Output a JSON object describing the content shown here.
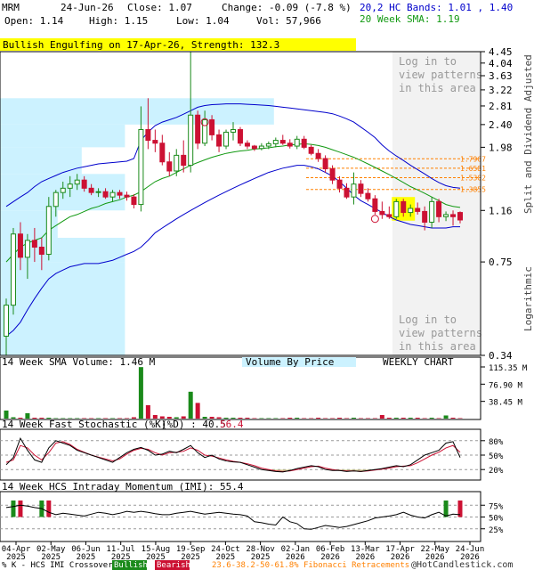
{
  "header": {
    "symbol": "MRM",
    "date": "24-Jun-26",
    "close": "Close: 1.07",
    "change": "Change: -0.09 (-7.8 %)",
    "open": "Open: 1.14",
    "high": "High: 1.15",
    "low": "Low: 1.04",
    "vol": "Vol: 57,966",
    "bands": "20,2 HC Bands: 1.01 , 1.40",
    "sma": "20 Week SMA: 1.19"
  },
  "colors": {
    "up": "#1a8a1a",
    "down": "#cc1133",
    "band": "#0000cc",
    "sma": "#119911",
    "vbp": "#ccf2ff",
    "fib": "#ff8000",
    "shade": "#f2f2f2",
    "banner": "#ffff00",
    "pattern": "#ffff00"
  },
  "banner": "Bullish Engulfing on 17-Apr-26, Strength: 132.3",
  "login_text": [
    "Log in to",
    "view patterns",
    "in this area"
  ],
  "labels": {
    "split": "Split and Dividend Adjusted",
    "log": "Logarithmic",
    "volume_title": "14 Week SMA Volume: 1.46 M",
    "vbp": "Volume By Price",
    "weekly": "WEEKLY CHART",
    "stoch_k": "14 Week Fast Stochastic (%K)",
    "stoch_d": "(%D) : 40.5",
    "stoch_val": "56.4",
    "imi": "14 Week HCS Intraday Momentum (IMI): 55.4",
    "footer_k": "% K - HCS IMI Crossover:",
    "bullish": "Bullish",
    "bearish": "Bearish",
    "fib": "23.6-38.2-50-61.8% Fibonacci Retracements",
    "copyright": "@HotCandlestick.com"
  },
  "chart_data": {
    "type": "candlestick",
    "price_ticks": [
      4.45,
      4.04,
      3.63,
      3.22,
      2.81,
      2.4,
      1.98,
      1.16,
      0.75,
      0.34
    ],
    "fib_levels": [
      1.7967,
      1.6581,
      1.5302,
      1.3855
    ],
    "fib_labels": [
      "1.7967",
      "1.6581",
      "1.5302",
      "1.3855"
    ],
    "vol_ticks": [
      "115.35 M",
      "76.90 M",
      "38.45 M"
    ],
    "stoch_ticks": [
      "80%",
      "50%",
      "20%"
    ],
    "imi_ticks": [
      "75%",
      "50%",
      "25%"
    ],
    "x_labels": [
      [
        "04-Apr",
        "2025"
      ],
      [
        "02-May",
        "2025"
      ],
      [
        "06-Jun",
        "2025"
      ],
      [
        "11-Jul",
        "2025"
      ],
      [
        "15-Aug",
        "2025"
      ],
      [
        "19-Sep",
        "2025"
      ],
      [
        "24-Oct",
        "2025"
      ],
      [
        "28-Nov",
        "2025"
      ],
      [
        "02-Jan",
        "2026"
      ],
      [
        "06-Feb",
        "2026"
      ],
      [
        "13-Mar",
        "2026"
      ],
      [
        "17-Apr",
        "2026"
      ],
      [
        "22-May",
        "2026"
      ],
      [
        "24-Jun",
        "2026"
      ]
    ],
    "candles": [
      [
        0.4,
        0.55,
        0.34,
        0.52
      ],
      [
        0.52,
        1.0,
        0.48,
        0.95
      ],
      [
        0.95,
        1.05,
        0.7,
        0.78
      ],
      [
        0.78,
        0.95,
        0.65,
        0.9
      ],
      [
        0.9,
        1.0,
        0.75,
        0.85
      ],
      [
        0.85,
        0.92,
        0.7,
        0.8
      ],
      [
        0.8,
        1.3,
        0.76,
        1.2
      ],
      [
        1.2,
        1.38,
        1.1,
        1.35
      ],
      [
        1.35,
        1.48,
        1.28,
        1.4
      ],
      [
        1.4,
        1.55,
        1.3,
        1.45
      ],
      [
        1.45,
        1.58,
        1.38,
        1.5
      ],
      [
        1.5,
        1.55,
        1.36,
        1.4
      ],
      [
        1.4,
        1.45,
        1.32,
        1.35
      ],
      [
        1.35,
        1.4,
        1.3,
        1.36
      ],
      [
        1.36,
        1.4,
        1.28,
        1.3
      ],
      [
        1.3,
        1.38,
        1.25,
        1.35
      ],
      [
        1.35,
        1.38,
        1.28,
        1.32
      ],
      [
        1.32,
        1.36,
        1.26,
        1.3
      ],
      [
        1.3,
        1.33,
        1.18,
        1.22
      ],
      [
        1.22,
        2.8,
        1.15,
        2.3
      ],
      [
        2.3,
        3.0,
        1.95,
        2.1
      ],
      [
        2.1,
        2.3,
        1.9,
        2.05
      ],
      [
        2.05,
        2.2,
        1.7,
        1.75
      ],
      [
        1.75,
        1.9,
        1.55,
        1.62
      ],
      [
        1.62,
        1.95,
        1.55,
        1.85
      ],
      [
        1.85,
        2.1,
        1.6,
        1.7
      ],
      [
        1.7,
        4.45,
        1.6,
        2.6
      ],
      [
        2.6,
        2.7,
        1.95,
        2.05
      ],
      [
        2.05,
        2.7,
        2.0,
        2.5
      ],
      [
        2.5,
        2.6,
        2.1,
        2.2
      ],
      [
        2.2,
        2.3,
        1.9,
        2.0
      ],
      [
        2.0,
        2.3,
        1.95,
        2.25
      ],
      [
        2.25,
        2.45,
        2.1,
        2.3
      ],
      [
        2.3,
        2.35,
        2.0,
        2.05
      ],
      [
        2.05,
        2.1,
        1.95,
        2.0
      ],
      [
        2.0,
        2.02,
        1.92,
        1.96
      ],
      [
        1.96,
        2.05,
        1.93,
        2.0
      ],
      [
        2.0,
        2.08,
        1.95,
        2.04
      ],
      [
        2.04,
        2.15,
        1.98,
        2.1
      ],
      [
        2.1,
        2.2,
        2.02,
        2.05
      ],
      [
        2.05,
        2.12,
        1.96,
        2.0
      ],
      [
        2.0,
        2.18,
        1.95,
        2.12
      ],
      [
        2.12,
        2.18,
        1.95,
        1.98
      ],
      [
        1.98,
        2.02,
        1.85,
        1.88
      ],
      [
        1.88,
        1.95,
        1.75,
        1.8
      ],
      [
        1.8,
        1.85,
        1.6,
        1.65
      ],
      [
        1.65,
        1.7,
        1.45,
        1.5
      ],
      [
        1.5,
        1.55,
        1.35,
        1.4
      ],
      [
        1.4,
        1.46,
        1.28,
        1.3
      ],
      [
        1.3,
        1.6,
        1.22,
        1.45
      ],
      [
        1.45,
        1.5,
        1.3,
        1.34
      ],
      [
        1.34,
        1.4,
        1.25,
        1.28
      ],
      [
        1.28,
        1.32,
        1.12,
        1.15
      ],
      [
        1.15,
        1.25,
        1.08,
        1.12
      ],
      [
        1.12,
        1.2,
        1.08,
        1.1
      ],
      [
        1.1,
        1.28,
        1.08,
        1.25
      ],
      [
        1.25,
        1.28,
        1.1,
        1.14
      ],
      [
        1.14,
        1.22,
        1.1,
        1.18
      ],
      [
        1.18,
        1.24,
        1.12,
        1.15
      ],
      [
        1.15,
        1.2,
        0.98,
        1.05
      ],
      [
        1.05,
        1.3,
        1.0,
        1.25
      ],
      [
        1.25,
        1.28,
        1.05,
        1.1
      ],
      [
        1.1,
        1.15,
        1.06,
        1.12
      ],
      [
        1.12,
        1.16,
        1.02,
        1.1
      ],
      [
        1.14,
        1.15,
        1.04,
        1.07
      ]
    ],
    "pattern_candles": [
      55,
      56,
      57
    ],
    "circle_marks": [
      [
        28,
        2.45
      ],
      [
        52,
        1.08
      ]
    ],
    "sma": [
      0.75,
      0.8,
      0.85,
      0.88,
      0.9,
      0.92,
      0.98,
      1.02,
      1.06,
      1.1,
      1.12,
      1.15,
      1.18,
      1.2,
      1.23,
      1.25,
      1.27,
      1.3,
      1.32,
      1.36,
      1.42,
      1.48,
      1.52,
      1.55,
      1.6,
      1.65,
      1.7,
      1.74,
      1.78,
      1.82,
      1.85,
      1.88,
      1.9,
      1.92,
      1.93,
      1.95,
      1.96,
      1.97,
      1.99,
      2.0,
      2.02,
      2.03,
      2.04,
      2.03,
      2.01,
      1.98,
      1.94,
      1.9,
      1.86,
      1.82,
      1.77,
      1.72,
      1.67,
      1.62,
      1.57,
      1.52,
      1.47,
      1.42,
      1.38,
      1.34,
      1.3,
      1.26,
      1.22,
      1.2,
      1.19
    ],
    "upper_band": [
      1.2,
      1.25,
      1.3,
      1.35,
      1.42,
      1.48,
      1.52,
      1.56,
      1.6,
      1.63,
      1.66,
      1.68,
      1.7,
      1.72,
      1.73,
      1.74,
      1.75,
      1.76,
      1.8,
      2.1,
      2.25,
      2.38,
      2.45,
      2.5,
      2.55,
      2.62,
      2.7,
      2.78,
      2.82,
      2.84,
      2.85,
      2.86,
      2.86,
      2.86,
      2.85,
      2.84,
      2.83,
      2.82,
      2.8,
      2.78,
      2.76,
      2.74,
      2.72,
      2.7,
      2.68,
      2.66,
      2.63,
      2.58,
      2.52,
      2.45,
      2.35,
      2.25,
      2.15,
      2.02,
      1.92,
      1.84,
      1.77,
      1.7,
      1.64,
      1.58,
      1.52,
      1.47,
      1.43,
      1.41,
      1.4
    ],
    "lower_band": [
      0.4,
      0.42,
      0.45,
      0.5,
      0.55,
      0.6,
      0.65,
      0.68,
      0.7,
      0.72,
      0.73,
      0.74,
      0.74,
      0.74,
      0.75,
      0.76,
      0.78,
      0.8,
      0.82,
      0.85,
      0.9,
      0.96,
      1.0,
      1.04,
      1.08,
      1.12,
      1.16,
      1.2,
      1.24,
      1.28,
      1.32,
      1.36,
      1.4,
      1.44,
      1.48,
      1.52,
      1.56,
      1.6,
      1.63,
      1.66,
      1.68,
      1.7,
      1.7,
      1.68,
      1.65,
      1.6,
      1.55,
      1.48,
      1.4,
      1.32,
      1.26,
      1.22,
      1.18,
      1.14,
      1.1,
      1.07,
      1.05,
      1.03,
      1.02,
      1.01,
      1.0,
      1.0,
      1.0,
      1.01,
      1.01
    ],
    "volume": [
      18,
      3,
      2,
      12,
      2,
      2,
      2,
      1,
      1,
      1,
      1,
      1,
      1,
      1,
      1,
      1,
      1,
      1,
      3,
      115,
      30,
      8,
      5,
      4,
      3,
      5,
      60,
      35,
      4,
      4,
      3,
      2,
      2,
      2,
      2,
      1,
      1,
      1,
      1,
      1,
      2,
      2,
      1,
      1,
      2,
      1,
      1,
      2,
      1,
      2,
      1,
      1,
      1,
      8,
      2,
      2,
      2,
      2,
      2,
      1,
      2,
      1,
      7,
      2,
      1
    ],
    "stoch_k": [
      30,
      45,
      85,
      60,
      40,
      35,
      65,
      80,
      75,
      70,
      60,
      55,
      50,
      45,
      40,
      35,
      45,
      55,
      62,
      66,
      60,
      50,
      52,
      58,
      55,
      62,
      70,
      55,
      45,
      50,
      42,
      38,
      36,
      35,
      30,
      25,
      20,
      18,
      16,
      15,
      18,
      22,
      25,
      28,
      26,
      20,
      18,
      18,
      16,
      17,
      16,
      18,
      20,
      22,
      25,
      28,
      26,
      30,
      40,
      50,
      55,
      60,
      75,
      78,
      45
    ],
    "stoch_d": [
      35,
      40,
      70,
      65,
      50,
      40,
      55,
      75,
      78,
      72,
      62,
      56,
      50,
      46,
      42,
      38,
      42,
      52,
      60,
      64,
      62,
      55,
      50,
      55,
      56,
      58,
      65,
      60,
      50,
      48,
      44,
      40,
      37,
      35,
      32,
      28,
      23,
      20,
      17,
      16,
      17,
      20,
      23,
      26,
      27,
      23,
      20,
      18,
      17,
      17,
      16,
      17,
      19,
      21,
      23,
      26,
      27,
      28,
      34,
      42,
      50,
      56,
      65,
      70,
      56
    ],
    "imi": [
      70,
      72,
      75,
      73,
      70,
      68,
      60,
      55,
      58,
      56,
      54,
      52,
      56,
      60,
      58,
      55,
      58,
      62,
      60,
      62,
      60,
      57,
      55,
      55,
      58,
      60,
      62,
      59,
      56,
      58,
      60,
      58,
      56,
      55,
      52,
      40,
      38,
      35,
      33,
      50,
      40,
      36,
      25,
      24,
      28,
      32,
      30,
      28,
      30,
      34,
      38,
      42,
      48,
      50,
      52,
      55,
      60,
      54,
      50,
      48,
      55,
      60,
      52,
      56,
      55
    ],
    "imi_markers": [
      [
        1,
        "bull"
      ],
      [
        2,
        "bear"
      ],
      [
        5,
        "bull"
      ],
      [
        6,
        "bear"
      ],
      [
        62,
        "bull"
      ],
      [
        64,
        "bear"
      ]
    ]
  }
}
